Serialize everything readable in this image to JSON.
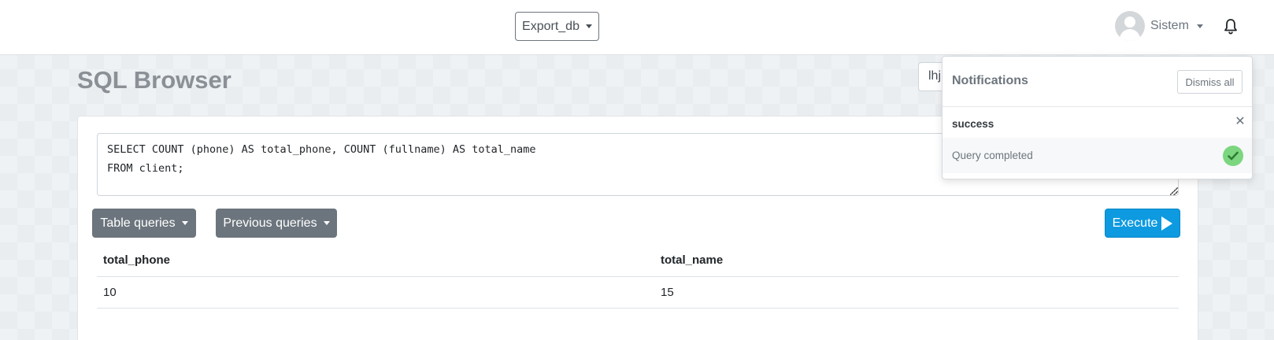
{
  "navbar": {
    "database": "Export_db",
    "user_name": "Sistem"
  },
  "page": {
    "title": "SQL Browser",
    "search_value": "lhj"
  },
  "editor": {
    "query": "SELECT COUNT (phone) AS total_phone, COUNT (fullname) AS total_name\nFROM client;"
  },
  "toolbar": {
    "table_queries_label": "Table queries",
    "previous_queries_label": "Previous queries",
    "execute_label": "Execute"
  },
  "results": {
    "columns": [
      "total_phone",
      "total_name"
    ],
    "rows": [
      [
        "10",
        "15"
      ]
    ]
  },
  "notifications": {
    "title": "Notifications",
    "dismiss_label": "Dismiss all",
    "items": [
      {
        "type": "success",
        "message": "Query completed"
      }
    ]
  },
  "colors": {
    "primary": "#0d9ae0",
    "secondary": "#6c757d",
    "success": "#7bd67f"
  },
  "icons": [
    "user-avatar-icon",
    "bell-icon",
    "chevron-down-icon",
    "play-icon",
    "close-icon",
    "check-icon"
  ]
}
